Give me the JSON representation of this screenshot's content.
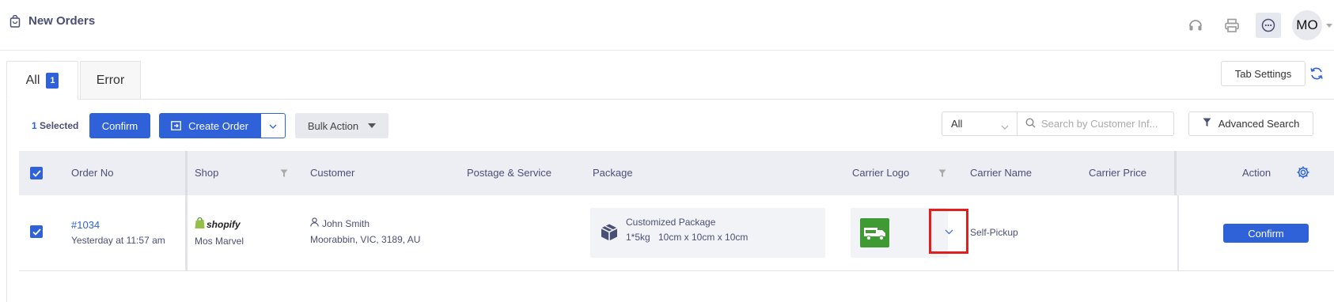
{
  "header": {
    "title": "New Orders",
    "title_icon": "bag-icon",
    "icons": [
      "headset-icon",
      "printer-icon",
      "chat-icon"
    ],
    "avatar_initials": "MO"
  },
  "tabs": [
    {
      "label": "All",
      "badge": "1",
      "active": true
    },
    {
      "label": "Error",
      "active": false
    }
  ],
  "tab_settings_label": "Tab Settings",
  "toolbar": {
    "selected_count": "1",
    "selected_label": "Selected",
    "confirm_label": "Confirm",
    "create_order_label": "Create Order",
    "bulk_action_label": "Bulk Action",
    "filter_value": "All",
    "search_placeholder": "Search by Customer Inf...",
    "advanced_search_label": "Advanced Search"
  },
  "table": {
    "columns": [
      "Order No",
      "Shop",
      "Customer",
      "Postage & Service",
      "Package",
      "Carrier Logo",
      "Carrier Name",
      "Carrier Price",
      "Action"
    ],
    "rows": [
      {
        "checked": true,
        "order_no": "#1034",
        "order_time": "Yesterday at 11:57 am",
        "shop_platform": "shopify",
        "shop_name": "Mos Marvel",
        "customer_name": "John Smith",
        "customer_address": "Moorabbin, VIC, 3189, AU",
        "postage_service": "",
        "package_name": "Customized Package",
        "package_qty_weight": "1*5kg",
        "package_dims": "10cm x 10cm x 10cm",
        "carrier_name": "Self-Pickup",
        "carrier_price": "",
        "action_label": "Confirm"
      }
    ]
  },
  "colors": {
    "primary": "#2f62d9",
    "header_text": "#4a4f75",
    "table_header_bg": "#edeef3",
    "carrier_logo_bg": "#3f9a33",
    "highlight_border": "#e0201f"
  }
}
